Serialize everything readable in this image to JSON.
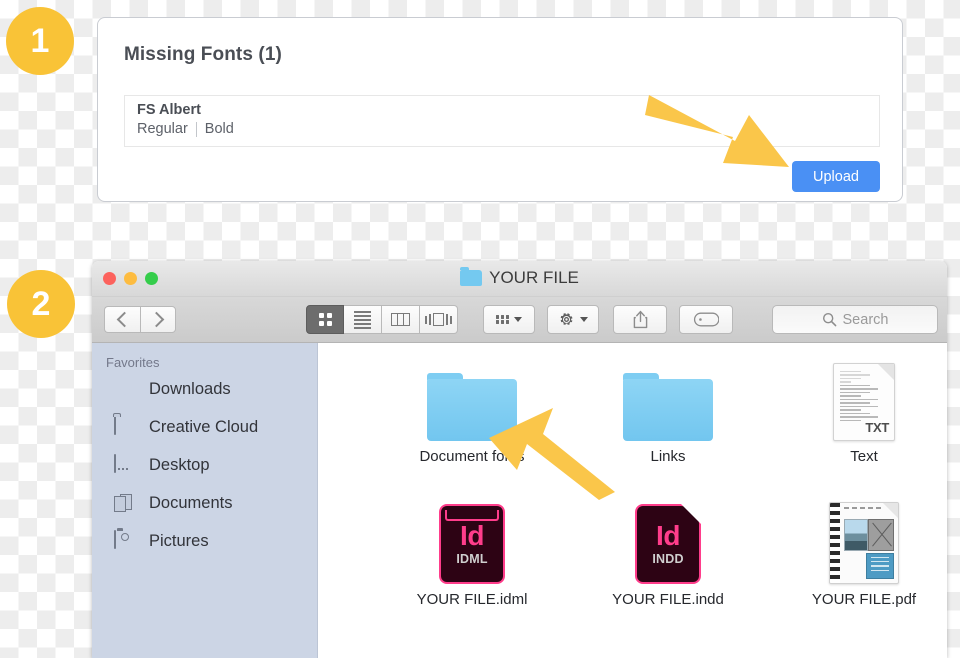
{
  "badges": {
    "one": "1",
    "two": "2"
  },
  "fonts_panel": {
    "title": "Missing Fonts (1)",
    "font_name": "FS Albert",
    "style_regular": "Regular",
    "style_bold": "Bold",
    "upload_label": "Upload",
    "accent_color": "#4a90f4",
    "arrow_color": "#fac64a"
  },
  "finder": {
    "window_title": "YOUR FILE",
    "traffic_lights": [
      "close",
      "minimize",
      "zoom"
    ],
    "toolbar": {
      "back": "back",
      "forward": "forward",
      "views": [
        {
          "name": "icon-view",
          "active": true
        },
        {
          "name": "list-view",
          "active": false
        },
        {
          "name": "column-view",
          "active": false
        },
        {
          "name": "gallery-view",
          "active": false
        }
      ],
      "arrange": "arrange",
      "action": "action",
      "share": "share",
      "tags": "tags",
      "search_placeholder": "Search"
    },
    "sidebar": {
      "header": "Favorites",
      "items": [
        {
          "label": "Downloads",
          "icon": "download-icon"
        },
        {
          "label": "Creative Cloud",
          "icon": "folder-icon"
        },
        {
          "label": "Desktop",
          "icon": "desktop-icon"
        },
        {
          "label": "Documents",
          "icon": "documents-icon"
        },
        {
          "label": "Pictures",
          "icon": "camera-icon"
        }
      ]
    },
    "files": [
      {
        "label": "Document fonts",
        "type": "folder"
      },
      {
        "label": "Links",
        "type": "folder"
      },
      {
        "label": "Text",
        "type": "txt",
        "badge": "TXT"
      },
      {
        "label": "YOUR FILE.idml",
        "type": "idml",
        "logo": "Id",
        "badge": "IDML"
      },
      {
        "label": "YOUR FILE.indd",
        "type": "indd",
        "logo": "Id",
        "badge": "INDD"
      },
      {
        "label": "YOUR FILE.pdf",
        "type": "pdf"
      }
    ]
  }
}
